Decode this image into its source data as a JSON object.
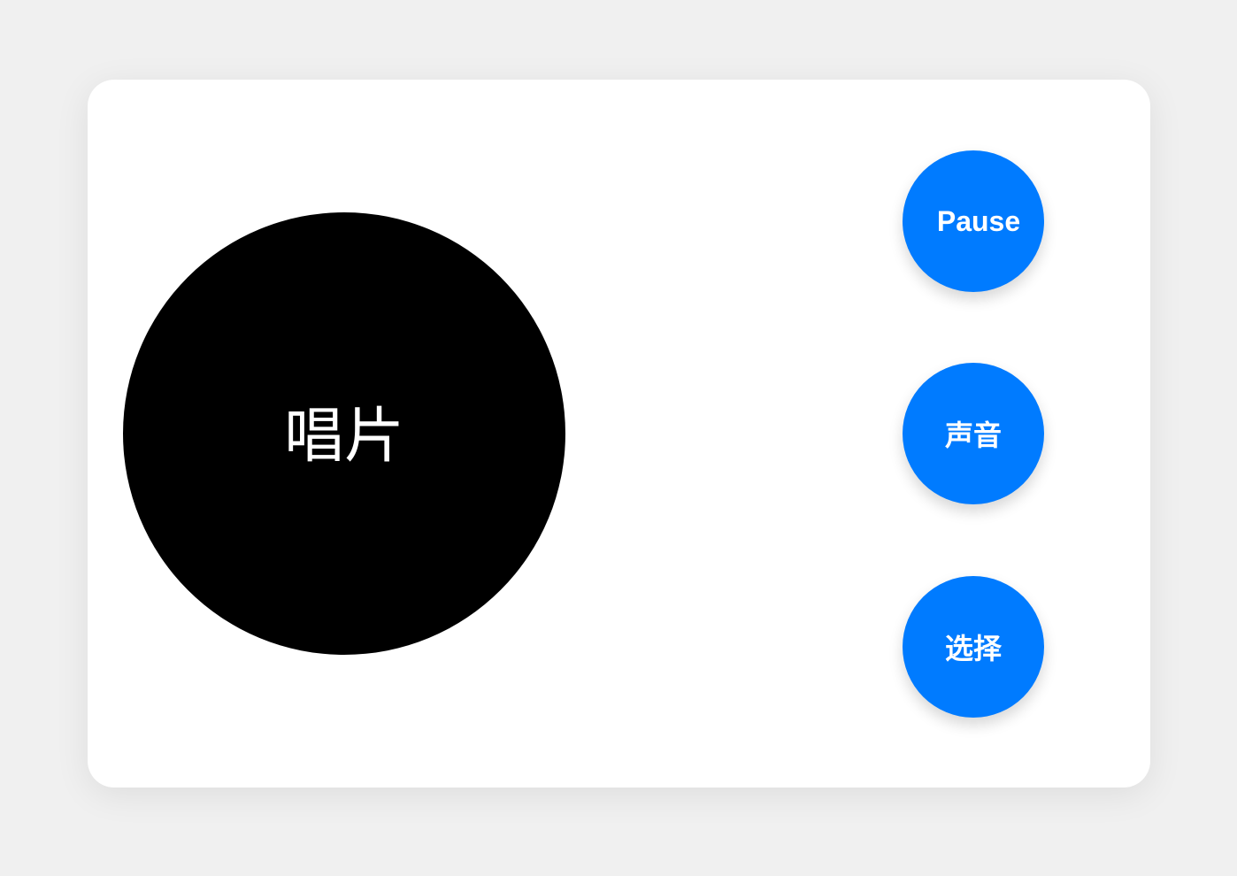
{
  "record": {
    "label": "唱片"
  },
  "controls": {
    "pause_label": "Pause",
    "sound_label": "声音",
    "select_label": "选择"
  },
  "colors": {
    "background": "#f0f0f0",
    "card": "#ffffff",
    "record": "#000000",
    "button": "#007bff",
    "button_text": "#ffffff"
  }
}
